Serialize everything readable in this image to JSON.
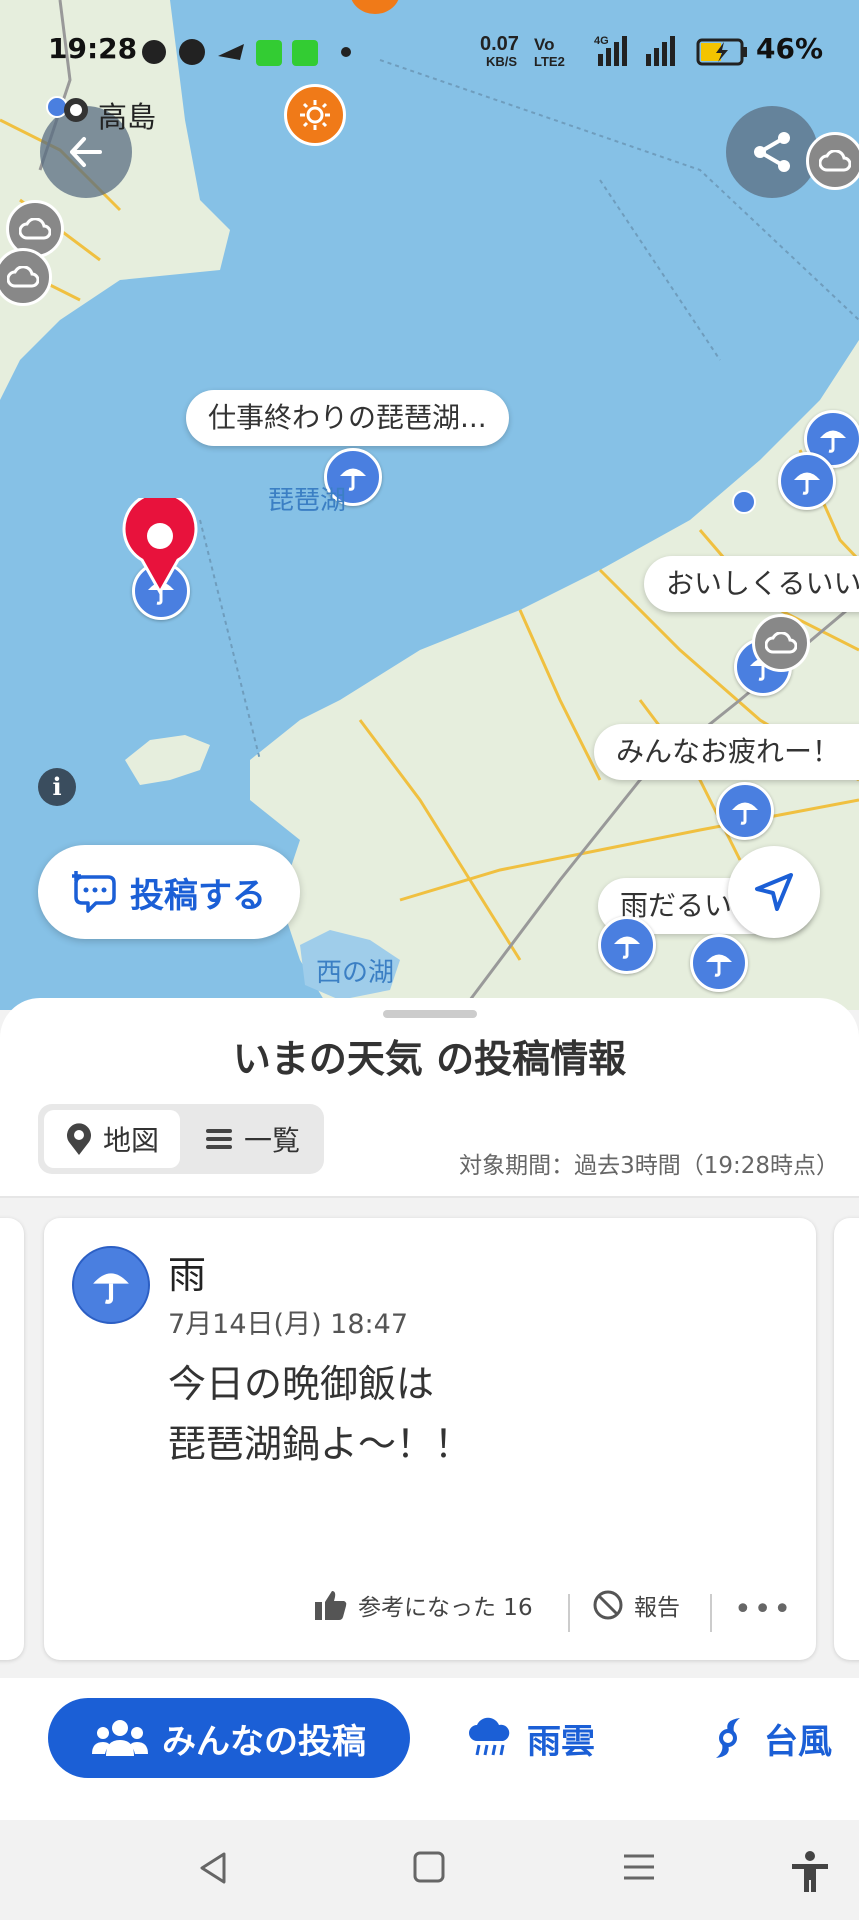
{
  "status_bar": {
    "time": "19:28",
    "net_speed": "0.07",
    "net_unit": "KB/S",
    "volte_top": "Vo",
    "volte_bottom": "LTE2",
    "signal_type": "4G",
    "battery": "46%"
  },
  "map": {
    "place_label_takashima": "高島",
    "lake_label": "琵琶湖",
    "nishinoko_label": "西の湖",
    "bubbles": [
      "仕事終わりの琵琶湖...",
      "おいしくるいい",
      "みんなお疲れー！",
      "雨だるい"
    ],
    "post_button_label": "投稿する",
    "info_label": "i"
  },
  "sheet": {
    "title": "いまの天気 の投稿情報",
    "view_map_label": "地図",
    "view_list_label": "一覧",
    "period": "対象期間：過去3時間（19:28時点）"
  },
  "card": {
    "weather": "雨",
    "date": "7月14日(月) 18:47",
    "body": "今日の晩御飯は\n琵琶湖鍋よ〜！！",
    "like_label": "参考になった 16",
    "report_label": "報告",
    "more_label": "•••"
  },
  "tabs": {
    "everyone": "みんなの投稿",
    "rain_cloud": "雨雲",
    "typhoon": "台風"
  },
  "colors": {
    "accent": "#1b5fd6",
    "water": "#86c1e6",
    "land": "#e6eedd",
    "pin_red": "#e8123c",
    "rain_pin": "#4a7fe0"
  }
}
